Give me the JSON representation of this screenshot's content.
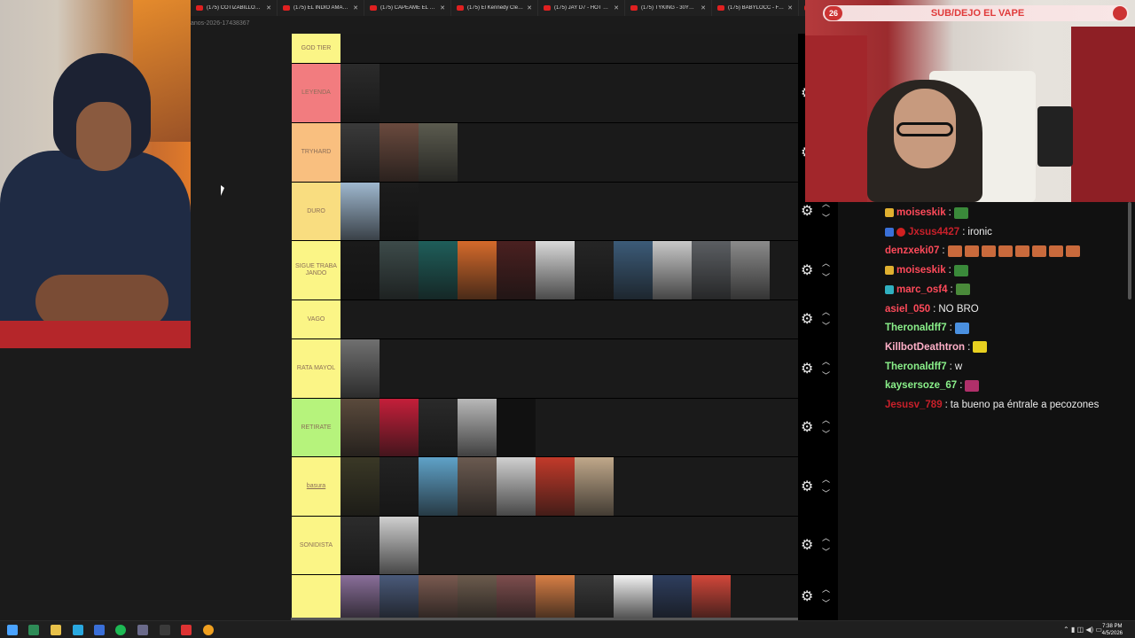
{
  "browser": {
    "tabs": [
      {
        "title": "(175) COTIZABILLONE - T"
      },
      {
        "title": "(175) EL INDIO AMARO"
      },
      {
        "title": "(175) CAPEAME EL DRILL"
      },
      {
        "title": "(175) El Kennedy Clemen"
      },
      {
        "title": "(175) JAY D7 - HOT FACT"
      },
      {
        "title": "(175) TYKING - 30Y1 (Vi"
      },
      {
        "title": "(175) BABYLOCC - FATAL"
      },
      {
        "title": "(17"
      }
    ],
    "url_fragment": "anos-2026-17438367"
  },
  "tiers": [
    {
      "label": "GOD TIER",
      "color": "#fbf586",
      "thumbs": []
    },
    {
      "label": "LEYENDA",
      "color": "#f27c7f",
      "thumbs": [
        "#2b2b2b"
      ]
    },
    {
      "label": "TRYHARD",
      "color": "#f9bf7f",
      "thumbs": [
        "#3a3a3a",
        "#6a4a3e",
        "#5b5b4f"
      ]
    },
    {
      "label": "DURO",
      "color": "#f9dd80",
      "thumbs": [
        "#9fb8cf",
        "#1c1c1c"
      ]
    },
    {
      "label": "SIGUE TRABAJANDO",
      "color": "#fbf586",
      "thumbs": [
        "#1a1a1a",
        "#3d4b4a",
        "#1f5e5a",
        "#d56a2b",
        "#4a2020",
        "#d9d9d9",
        "#252525",
        "#3c5b78",
        "#c8c8c8",
        "#5b5e62",
        "#8b8b8b"
      ]
    },
    {
      "label": "VAGO",
      "color": "#fbf586",
      "thumbs": []
    },
    {
      "label": "RATA MAYOL",
      "color": "#fbf586",
      "thumbs": [
        "#707070"
      ]
    },
    {
      "label": "RETIRATE",
      "color": "#b6f37c",
      "thumbs": [
        "#5a4a3c",
        "#c41f3a",
        "#2a2a2a",
        "#b8b8b8",
        "#111111"
      ]
    },
    {
      "label": "basura",
      "color": "#fbf586",
      "thumbs": [
        "#3a3826",
        "#232323",
        "#5fa2c8",
        "#6a5a50",
        "#d0d0d0",
        "#c23a2a",
        "#c0a88a"
      ]
    },
    {
      "label": "SONIDISTA",
      "color": "#fbf586",
      "thumbs": [
        "#2c2c2c",
        "#cfcfcf"
      ]
    },
    {
      "label": "",
      "color": "#fbf586",
      "thumbs": [
        "#8a6f9a",
        "#4a5a7a",
        "#7a5a50",
        "#6c5b4d",
        "#7e4e4e",
        "#d87f45",
        "#3a3a3a",
        "#f2f2f2",
        "#2e3e5e",
        "#d2473a"
      ]
    }
  ],
  "alert": {
    "count": "26",
    "text": "SUB/DEJO EL VAPE"
  },
  "chat": [
    {
      "badge": "#e0b030",
      "badge2": "",
      "user": "moiseskik",
      "user_color": "#ff4a5a",
      "text": "",
      "emotes": 1,
      "emote_color": "#3a8a3a"
    },
    {
      "badge": "#3a70d8",
      "badge2": "#d02020",
      "user": "Jxsus4427",
      "user_color": "#c8202a",
      "text": "ironic",
      "emotes": 0,
      "emote_color": ""
    },
    {
      "badge": "",
      "badge2": "",
      "user": "denzxeki07",
      "user_color": "#ff4a5a",
      "text": "",
      "emotes": 8,
      "emote_color": "#c96a3c"
    },
    {
      "badge": "#e0b030",
      "badge2": "",
      "user": "moiseskik",
      "user_color": "#ff4a5a",
      "text": "",
      "emotes": 1,
      "emote_color": "#3a8a3a"
    },
    {
      "badge": "#30b0c0",
      "badge2": "",
      "user": "marc_osf4",
      "user_color": "#ff4a5a",
      "text": "",
      "emotes": 1,
      "emote_color": "#4a8a3a"
    },
    {
      "badge": "",
      "badge2": "",
      "user": "asiel_050",
      "user_color": "#ff4a5a",
      "text": "NO BRO",
      "emotes": 0,
      "emote_color": ""
    },
    {
      "badge": "",
      "badge2": "",
      "user": "Theronaldff7",
      "user_color": "#8af08a",
      "text": "",
      "emotes": 1,
      "emote_color": "#4a90e0"
    },
    {
      "badge": "",
      "badge2": "",
      "user": "KillbotDeathtron",
      "user_color": "#ffb0c8",
      "text": "",
      "emotes": 1,
      "emote_color": "#e8d020"
    },
    {
      "badge": "",
      "badge2": "",
      "user": "Theronaldff7",
      "user_color": "#8af08a",
      "text": "w",
      "emotes": 0,
      "emote_color": ""
    },
    {
      "badge": "",
      "badge2": "",
      "user": "kaysersoze_67",
      "user_color": "#8af08a",
      "text": "",
      "emotes": 1,
      "emote_color": "#b0306a"
    },
    {
      "badge": "",
      "badge2": "",
      "user": "Jesusv_789",
      "user_color": "#c8202a",
      "text": "ta bueno pa éntrale a pecozones",
      "emotes": 0,
      "emote_color": ""
    }
  ],
  "taskbar": {
    "time": "7:38 PM",
    "date": "4/5/2026",
    "icons": [
      {
        "name": "windows-start-icon",
        "color": "#4aa3ff"
      },
      {
        "name": "app-green-icon",
        "color": "#2e8b57"
      },
      {
        "name": "file-explorer-icon",
        "color": "#e8c14a"
      },
      {
        "name": "edge-browser-icon",
        "color": "#29a8e0"
      },
      {
        "name": "app-store-icon",
        "color": "#3a6fd8"
      },
      {
        "name": "spotify-icon",
        "color": "#1db954"
      },
      {
        "name": "app-icon",
        "color": "#6a6a8a"
      },
      {
        "name": "obs-icon",
        "color": "#3a3a3a"
      },
      {
        "name": "app-red-icon",
        "color": "#d33"
      },
      {
        "name": "chrome-icon",
        "color": "#f0a020"
      }
    ]
  }
}
